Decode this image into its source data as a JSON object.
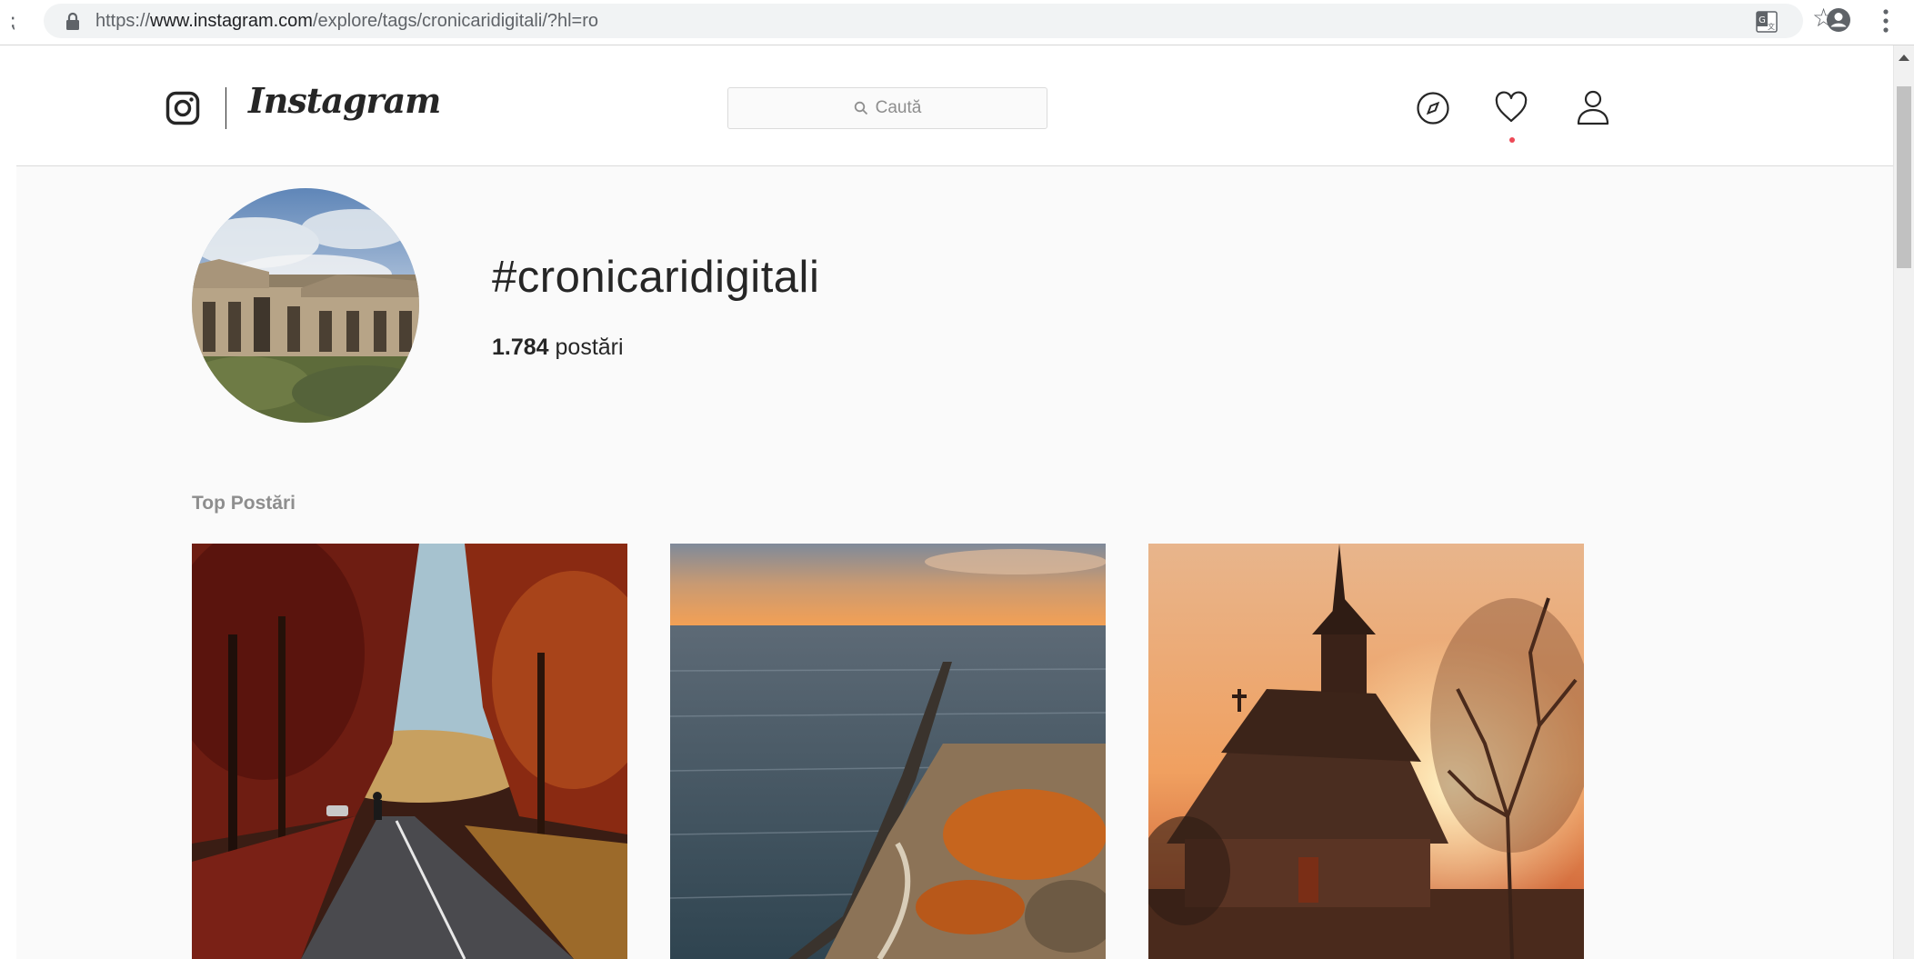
{
  "browser": {
    "url_scheme": "https://",
    "url_host": "www.instagram.com",
    "url_path": "/explore/tags/cronicaridigitali/?hl=ro",
    "icons": [
      "lock-icon",
      "translate-icon",
      "star-icon",
      "account-icon",
      "menu-icon"
    ]
  },
  "header": {
    "logo_text": "Instagram",
    "search_placeholder": "Caută",
    "nav_icons": [
      "explore-compass-icon",
      "activity-heart-icon",
      "profile-icon"
    ]
  },
  "tag": {
    "title": "#cronicaridigitali",
    "post_count": "1.784",
    "post_count_label": " postări"
  },
  "top_posts": {
    "heading": "Top Postări"
  },
  "colors": {
    "page_background": "#fafafa",
    "border": "#dbdbdb",
    "muted_text": "#8e8e8e",
    "notification_dot": "#ed4956"
  }
}
